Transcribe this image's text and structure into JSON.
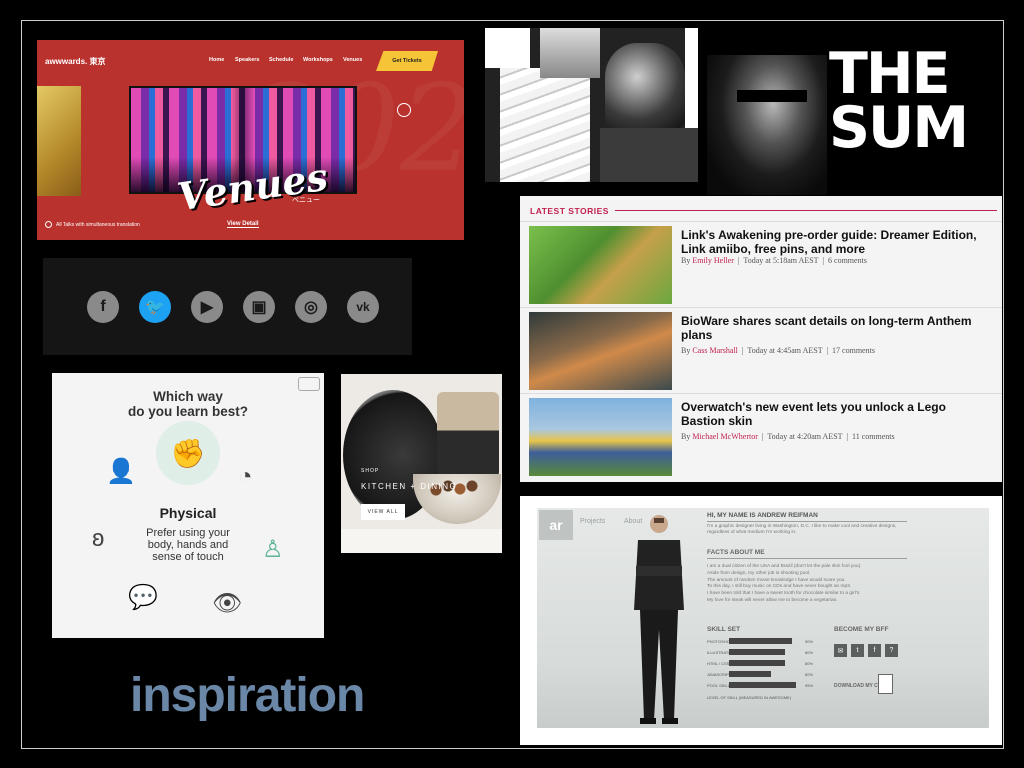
{
  "awwwards": {
    "brand": "awwwards. 東京",
    "nav": [
      "Home",
      "Speakers",
      "Schedule",
      "Workshops",
      "Venues"
    ],
    "cta": "Get Tickets",
    "hero_title": "Venues",
    "hero_kana": "ベニュー",
    "footer_note": "All Talks with simultaneous translation",
    "detail_link": "View Detail"
  },
  "the_sum": {
    "line1": "THE",
    "line2": "SUM"
  },
  "social_icons": [
    {
      "name": "facebook-icon",
      "glyph": "f"
    },
    {
      "name": "twitter-icon",
      "glyph": "🐦"
    },
    {
      "name": "youtube-icon",
      "glyph": "▶"
    },
    {
      "name": "twitch-icon",
      "glyph": "▣"
    },
    {
      "name": "instagram-icon",
      "glyph": "◎"
    },
    {
      "name": "vk-icon",
      "glyph": "vk"
    }
  ],
  "stories": {
    "header": "LATEST STORIES",
    "items": [
      {
        "title": "Link's Awakening pre-order guide: Dreamer Edition, Link amiibo, free pins, and more",
        "by": "By",
        "author": "Emily Heller",
        "time": "Today at 5:18am AEST",
        "comments": "6 comments"
      },
      {
        "title": "BioWare shares scant details on long-term Anthem plans",
        "by": "By",
        "author": "Cass Marshall",
        "time": "Today at 4:45am AEST",
        "comments": "17 comments"
      },
      {
        "title": "Overwatch's new event lets you unlock a Lego Bastion skin",
        "by": "By",
        "author": "Michael McWhertor",
        "time": "Today at 4:20am AEST",
        "comments": "11 comments"
      }
    ]
  },
  "learn": {
    "question_line1": "Which way",
    "question_line2": "do you learn best?",
    "heading": "Physical",
    "desc_line1": "Prefer using your",
    "desc_line2": "body, hands and",
    "desc_line3": "sense of touch"
  },
  "shop": {
    "kicker": "SHOP",
    "title": "KITCHEN + DINING",
    "button": "VIEW ALL"
  },
  "andrew": {
    "logo": "ar",
    "nav": [
      "Projects",
      "About"
    ],
    "heading": "HI, MY NAME IS ANDREW REIFMAN",
    "intro": "I'm a graphic designer living in Washington, D.C. I like to make cool and creative designs, regardless of what medium I'm working in.",
    "facts_heading": "FACTS ABOUT ME",
    "facts": [
      "I am a dual citizen of the USA and Brazil (don't let the pale skin fool you).",
      "Aside from design, my other job is shooting pool.",
      "The amount of random movie knowledge I have would scare you.",
      "To this day, I still buy music on CDs and have never bought an mp3.",
      "I have been told that I have a sweet tooth for chocolate similar to a girl's.",
      "My love for steak will never allow me to become a vegetarian."
    ],
    "skill_heading": "SKILL SET",
    "skills": [
      {
        "name": "PHOTOSHOP",
        "level": 0.9,
        "pct": "90%"
      },
      {
        "name": "ILLUSTRATOR",
        "level": 0.8,
        "pct": "80%"
      },
      {
        "name": "HTML / CSS",
        "level": 0.8,
        "pct": "80%"
      },
      {
        "name": "JAVASCRIPT (JQUERY)",
        "level": 0.6,
        "pct": "60%"
      },
      {
        "name": "POOL SKILLS",
        "level": 0.95,
        "pct": "95%"
      }
    ],
    "skill_note": "LEVEL OF SKILL (MEASURED IN AWESOME)",
    "bff_heading": "BECOME MY BFF",
    "bff_icons": [
      "✉",
      "t",
      "f",
      "?"
    ],
    "cv_link": "DOWNLOAD MY CV"
  },
  "caption": "inspiration",
  "colors": {
    "accent_red": "#c0214e",
    "awwwards_red": "#b9322e",
    "twitter_blue": "#1da1f2",
    "caption_blue": "#6b87a8"
  }
}
